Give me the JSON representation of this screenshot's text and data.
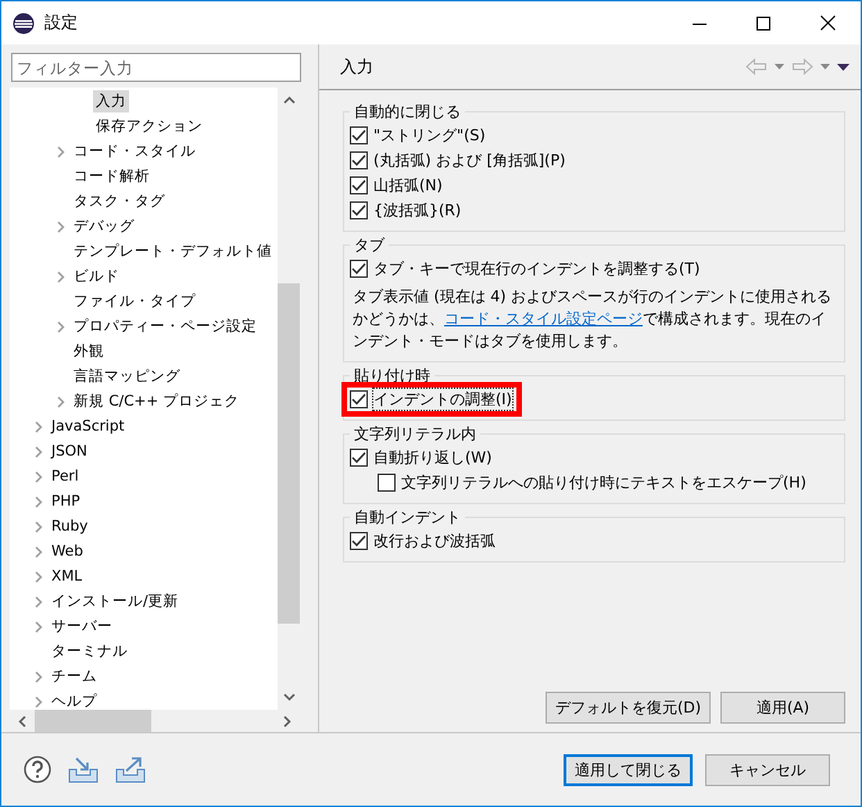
{
  "window": {
    "title": "設定"
  },
  "filter": {
    "placeholder": "フィルター入力"
  },
  "tree": [
    {
      "children": [
        {
          "children": [
            {
              "label": "入力",
              "selected": true,
              "expandable": false
            },
            {
              "label": "保存アクション",
              "selected": false,
              "expandable": false
            }
          ]
        },
        {
          "label": "コード・スタイル",
          "selected": false,
          "expandable": true
        },
        {
          "label": "コード解析",
          "selected": false,
          "expandable": false
        },
        {
          "label": "タスク・タグ",
          "selected": false,
          "expandable": false
        },
        {
          "label": "デバッグ",
          "selected": false,
          "expandable": true
        },
        {
          "label": "テンプレート・デフォルト値",
          "selected": false,
          "expandable": false
        },
        {
          "label": "ビルド",
          "selected": false,
          "expandable": true
        },
        {
          "label": "ファイル・タイプ",
          "selected": false,
          "expandable": false
        },
        {
          "label": "プロパティー・ページ設定",
          "selected": false,
          "expandable": true
        },
        {
          "label": "外観",
          "selected": false,
          "expandable": false
        },
        {
          "label": "言語マッピング",
          "selected": false,
          "expandable": false
        },
        {
          "label": "新規 C/C++ プロジェク",
          "selected": false,
          "expandable": true
        }
      ]
    },
    {
      "label": "JavaScript",
      "selected": false,
      "expandable": true
    },
    {
      "label": "JSON",
      "selected": false,
      "expandable": true
    },
    {
      "label": "Perl",
      "selected": false,
      "expandable": true
    },
    {
      "label": "PHP",
      "selected": false,
      "expandable": true
    },
    {
      "label": "Ruby",
      "selected": false,
      "expandable": true
    },
    {
      "label": "Web",
      "selected": false,
      "expandable": true
    },
    {
      "label": "XML",
      "selected": false,
      "expandable": true
    },
    {
      "label": "インストール/更新",
      "selected": false,
      "expandable": true
    },
    {
      "label": "サーバー",
      "selected": false,
      "expandable": true
    },
    {
      "label": "ターミナル",
      "selected": false,
      "expandable": false
    },
    {
      "label": "チーム",
      "selected": false,
      "expandable": true
    },
    {
      "label": "ヘルプ",
      "selected": false,
      "expandable": true
    }
  ],
  "page": {
    "title": "入力",
    "groups": [
      {
        "title": "自動的に閉じる",
        "items": [
          {
            "kind": "checkbox",
            "label": "\"ストリング\"(S)",
            "checked": true,
            "highlighted": false
          },
          {
            "kind": "checkbox",
            "label": "(丸括弧) および [角括弧](P)",
            "checked": true,
            "highlighted": false
          },
          {
            "kind": "checkbox",
            "label": "山括弧(N)",
            "checked": true,
            "highlighted": false
          },
          {
            "kind": "checkbox",
            "label": "{波括弧}(R)",
            "checked": true,
            "highlighted": false
          }
        ]
      },
      {
        "title": "タブ",
        "items": [
          {
            "kind": "checkbox",
            "label": "タブ・キーで現在行のインデントを調整する(T)",
            "checked": true,
            "highlighted": false
          },
          {
            "kind": "note",
            "text": "タブ表示値 (現在は 4) およびスペースが行のインデントに使用されるかどうかは、",
            "link": "コード・スタイル設定ページ",
            "text_after": "で構成されます。現在のインデント・モードはタブを使用します。"
          }
        ]
      },
      {
        "title": "貼り付け時",
        "items": [
          {
            "kind": "checkbox",
            "label": "インデントの調整(I)",
            "checked": true,
            "highlighted": true
          }
        ]
      },
      {
        "title": "文字列リテラル内",
        "items": [
          {
            "kind": "checkbox",
            "label": "自動折り返し(W)",
            "checked": true,
            "highlighted": false,
            "children": [
              {
                "kind": "checkbox",
                "label": "文字列リテラルへの貼り付け時にテキストをエスケープ(H)",
                "checked": false,
                "highlighted": false
              }
            ]
          }
        ]
      },
      {
        "title": "自動インデント",
        "items": [
          {
            "kind": "checkbox",
            "label": "改行および波括弧",
            "checked": true,
            "highlighted": false
          }
        ]
      }
    ],
    "buttons": [
      "デフォルトを復元(D)",
      "適用(A)"
    ]
  },
  "dialog_buttons": [
    {
      "label": "適用して閉じる",
      "default": true
    },
    {
      "label": "キャンセル",
      "default": false
    }
  ]
}
